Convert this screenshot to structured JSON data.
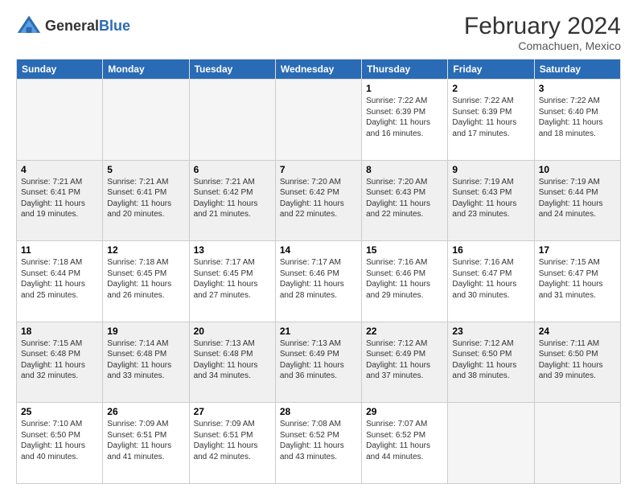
{
  "header": {
    "logo_general": "General",
    "logo_blue": "Blue",
    "month_year": "February 2024",
    "location": "Comachuen, Mexico"
  },
  "weekdays": [
    "Sunday",
    "Monday",
    "Tuesday",
    "Wednesday",
    "Thursday",
    "Friday",
    "Saturday"
  ],
  "rows": [
    [
      {
        "day": "",
        "info": "",
        "empty": true
      },
      {
        "day": "",
        "info": "",
        "empty": true
      },
      {
        "day": "",
        "info": "",
        "empty": true
      },
      {
        "day": "",
        "info": "",
        "empty": true
      },
      {
        "day": "1",
        "info": "Sunrise: 7:22 AM\nSunset: 6:39 PM\nDaylight: 11 hours\nand 16 minutes.",
        "empty": false
      },
      {
        "day": "2",
        "info": "Sunrise: 7:22 AM\nSunset: 6:39 PM\nDaylight: 11 hours\nand 17 minutes.",
        "empty": false
      },
      {
        "day": "3",
        "info": "Sunrise: 7:22 AM\nSunset: 6:40 PM\nDaylight: 11 hours\nand 18 minutes.",
        "empty": false
      }
    ],
    [
      {
        "day": "4",
        "info": "Sunrise: 7:21 AM\nSunset: 6:41 PM\nDaylight: 11 hours\nand 19 minutes.",
        "empty": false
      },
      {
        "day": "5",
        "info": "Sunrise: 7:21 AM\nSunset: 6:41 PM\nDaylight: 11 hours\nand 20 minutes.",
        "empty": false
      },
      {
        "day": "6",
        "info": "Sunrise: 7:21 AM\nSunset: 6:42 PM\nDaylight: 11 hours\nand 21 minutes.",
        "empty": false
      },
      {
        "day": "7",
        "info": "Sunrise: 7:20 AM\nSunset: 6:42 PM\nDaylight: 11 hours\nand 22 minutes.",
        "empty": false
      },
      {
        "day": "8",
        "info": "Sunrise: 7:20 AM\nSunset: 6:43 PM\nDaylight: 11 hours\nand 22 minutes.",
        "empty": false
      },
      {
        "day": "9",
        "info": "Sunrise: 7:19 AM\nSunset: 6:43 PM\nDaylight: 11 hours\nand 23 minutes.",
        "empty": false
      },
      {
        "day": "10",
        "info": "Sunrise: 7:19 AM\nSunset: 6:44 PM\nDaylight: 11 hours\nand 24 minutes.",
        "empty": false
      }
    ],
    [
      {
        "day": "11",
        "info": "Sunrise: 7:18 AM\nSunset: 6:44 PM\nDaylight: 11 hours\nand 25 minutes.",
        "empty": false
      },
      {
        "day": "12",
        "info": "Sunrise: 7:18 AM\nSunset: 6:45 PM\nDaylight: 11 hours\nand 26 minutes.",
        "empty": false
      },
      {
        "day": "13",
        "info": "Sunrise: 7:17 AM\nSunset: 6:45 PM\nDaylight: 11 hours\nand 27 minutes.",
        "empty": false
      },
      {
        "day": "14",
        "info": "Sunrise: 7:17 AM\nSunset: 6:46 PM\nDaylight: 11 hours\nand 28 minutes.",
        "empty": false
      },
      {
        "day": "15",
        "info": "Sunrise: 7:16 AM\nSunset: 6:46 PM\nDaylight: 11 hours\nand 29 minutes.",
        "empty": false
      },
      {
        "day": "16",
        "info": "Sunrise: 7:16 AM\nSunset: 6:47 PM\nDaylight: 11 hours\nand 30 minutes.",
        "empty": false
      },
      {
        "day": "17",
        "info": "Sunrise: 7:15 AM\nSunset: 6:47 PM\nDaylight: 11 hours\nand 31 minutes.",
        "empty": false
      }
    ],
    [
      {
        "day": "18",
        "info": "Sunrise: 7:15 AM\nSunset: 6:48 PM\nDaylight: 11 hours\nand 32 minutes.",
        "empty": false
      },
      {
        "day": "19",
        "info": "Sunrise: 7:14 AM\nSunset: 6:48 PM\nDaylight: 11 hours\nand 33 minutes.",
        "empty": false
      },
      {
        "day": "20",
        "info": "Sunrise: 7:13 AM\nSunset: 6:48 PM\nDaylight: 11 hours\nand 34 minutes.",
        "empty": false
      },
      {
        "day": "21",
        "info": "Sunrise: 7:13 AM\nSunset: 6:49 PM\nDaylight: 11 hours\nand 36 minutes.",
        "empty": false
      },
      {
        "day": "22",
        "info": "Sunrise: 7:12 AM\nSunset: 6:49 PM\nDaylight: 11 hours\nand 37 minutes.",
        "empty": false
      },
      {
        "day": "23",
        "info": "Sunrise: 7:12 AM\nSunset: 6:50 PM\nDaylight: 11 hours\nand 38 minutes.",
        "empty": false
      },
      {
        "day": "24",
        "info": "Sunrise: 7:11 AM\nSunset: 6:50 PM\nDaylight: 11 hours\nand 39 minutes.",
        "empty": false
      }
    ],
    [
      {
        "day": "25",
        "info": "Sunrise: 7:10 AM\nSunset: 6:50 PM\nDaylight: 11 hours\nand 40 minutes.",
        "empty": false
      },
      {
        "day": "26",
        "info": "Sunrise: 7:09 AM\nSunset: 6:51 PM\nDaylight: 11 hours\nand 41 minutes.",
        "empty": false
      },
      {
        "day": "27",
        "info": "Sunrise: 7:09 AM\nSunset: 6:51 PM\nDaylight: 11 hours\nand 42 minutes.",
        "empty": false
      },
      {
        "day": "28",
        "info": "Sunrise: 7:08 AM\nSunset: 6:52 PM\nDaylight: 11 hours\nand 43 minutes.",
        "empty": false
      },
      {
        "day": "29",
        "info": "Sunrise: 7:07 AM\nSunset: 6:52 PM\nDaylight: 11 hours\nand 44 minutes.",
        "empty": false
      },
      {
        "day": "",
        "info": "",
        "empty": true
      },
      {
        "day": "",
        "info": "",
        "empty": true
      }
    ]
  ]
}
